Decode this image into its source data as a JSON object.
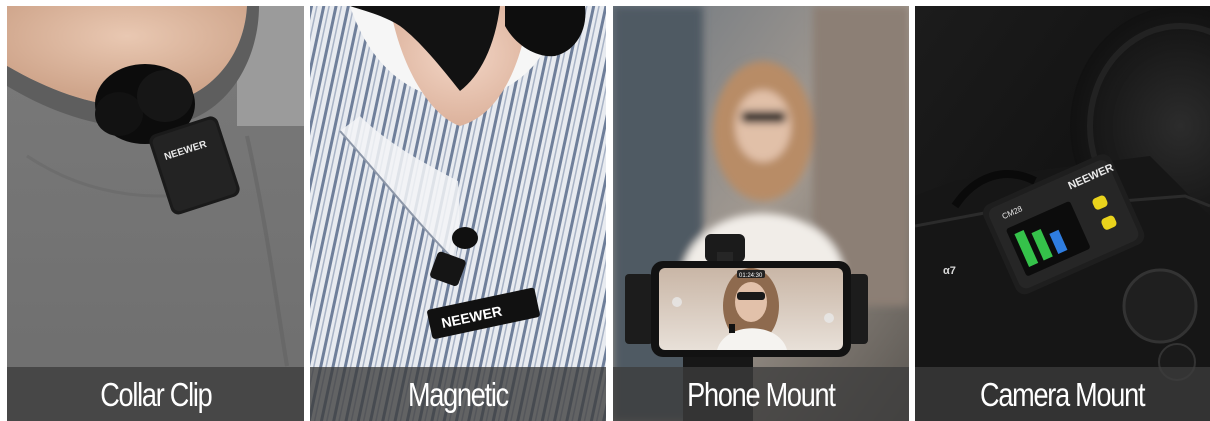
{
  "panels": [
    {
      "caption": "Collar Clip",
      "brand_text": "NEEWER"
    },
    {
      "caption": "Magnetic",
      "brand_text": "NEEWER"
    },
    {
      "caption": "Phone Mount",
      "phone_time": "01:24:30"
    },
    {
      "caption": "Camera Mount",
      "brand_text": "NEEWER",
      "model_text": "CM28",
      "camera_badge": "α7"
    }
  ],
  "colors": {
    "caption_bar": "#3c3c3c",
    "caption_text": "#ffffff",
    "accent_yellow": "#e9d31c",
    "screen_green": "#35c24a"
  }
}
